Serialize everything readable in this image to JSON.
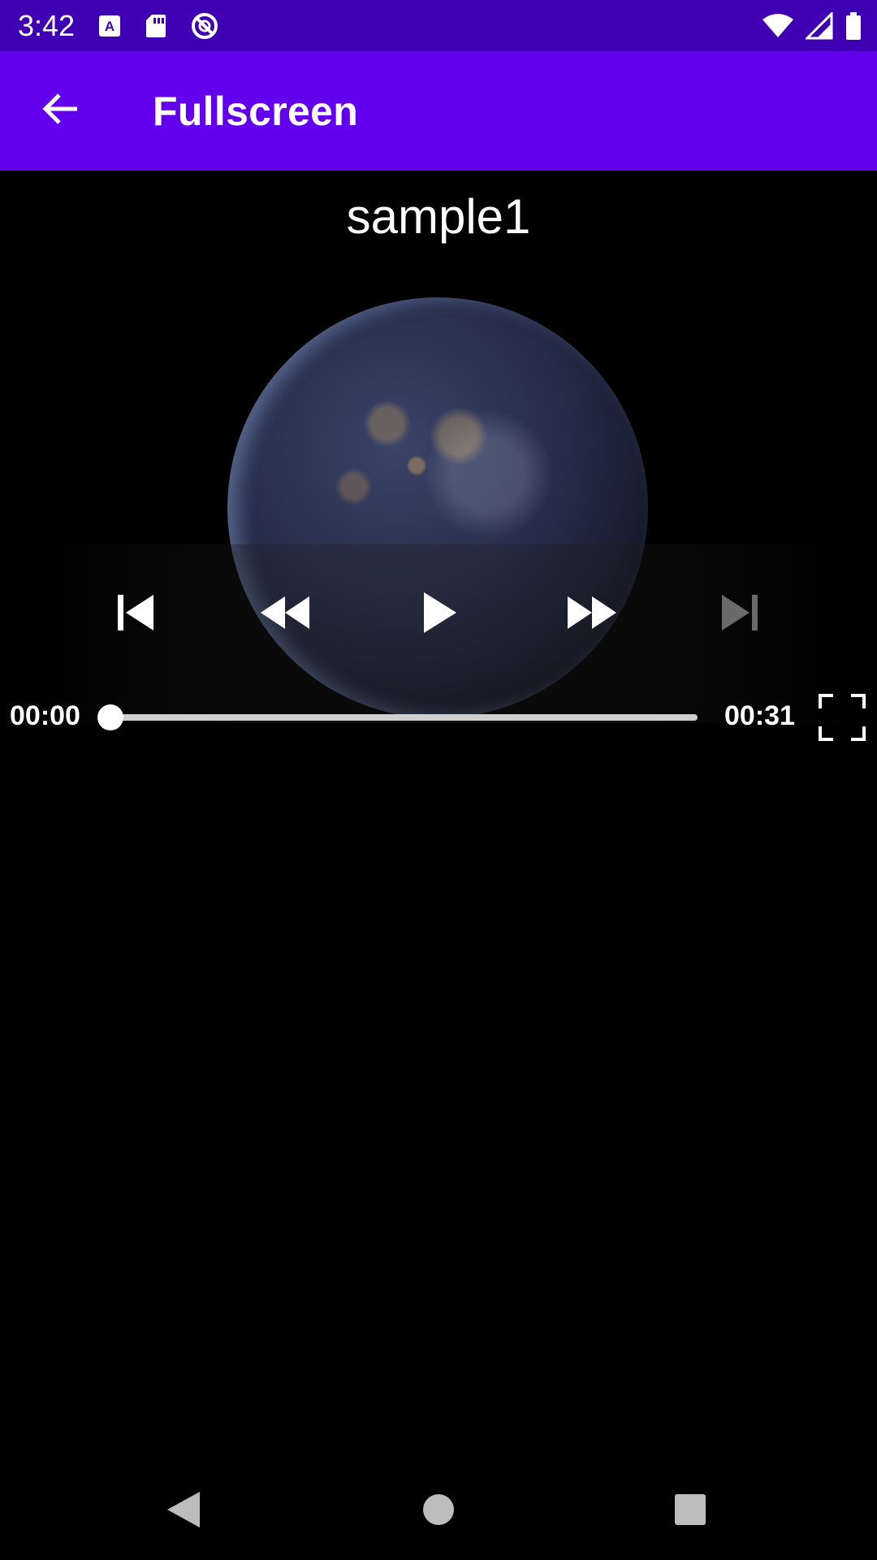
{
  "status_bar": {
    "time": "3:42",
    "left_icons": [
      "a-badge-icon",
      "sd-card-icon",
      "no-entry-icon"
    ],
    "right_icons": [
      "wifi-icon",
      "signal-icon",
      "battery-icon"
    ]
  },
  "app_bar": {
    "back_icon": "arrow-back-icon",
    "title": "Fullscreen",
    "background": "#6200ee",
    "status_background": "#3f00b4"
  },
  "video": {
    "title": "sample1",
    "playing": false
  },
  "controls": {
    "previous": "skip-previous-icon",
    "rewind": "rewind-icon",
    "play": "play-icon",
    "fast_forward": "fast-forward-icon",
    "next": "skip-next-icon",
    "next_enabled": false
  },
  "seek": {
    "current_time": "00:00",
    "total_time": "00:31",
    "progress": 0.0
  },
  "nav_bar": {
    "back": "nav-back-icon",
    "home": "nav-home-icon",
    "recents": "nav-recents-icon"
  }
}
